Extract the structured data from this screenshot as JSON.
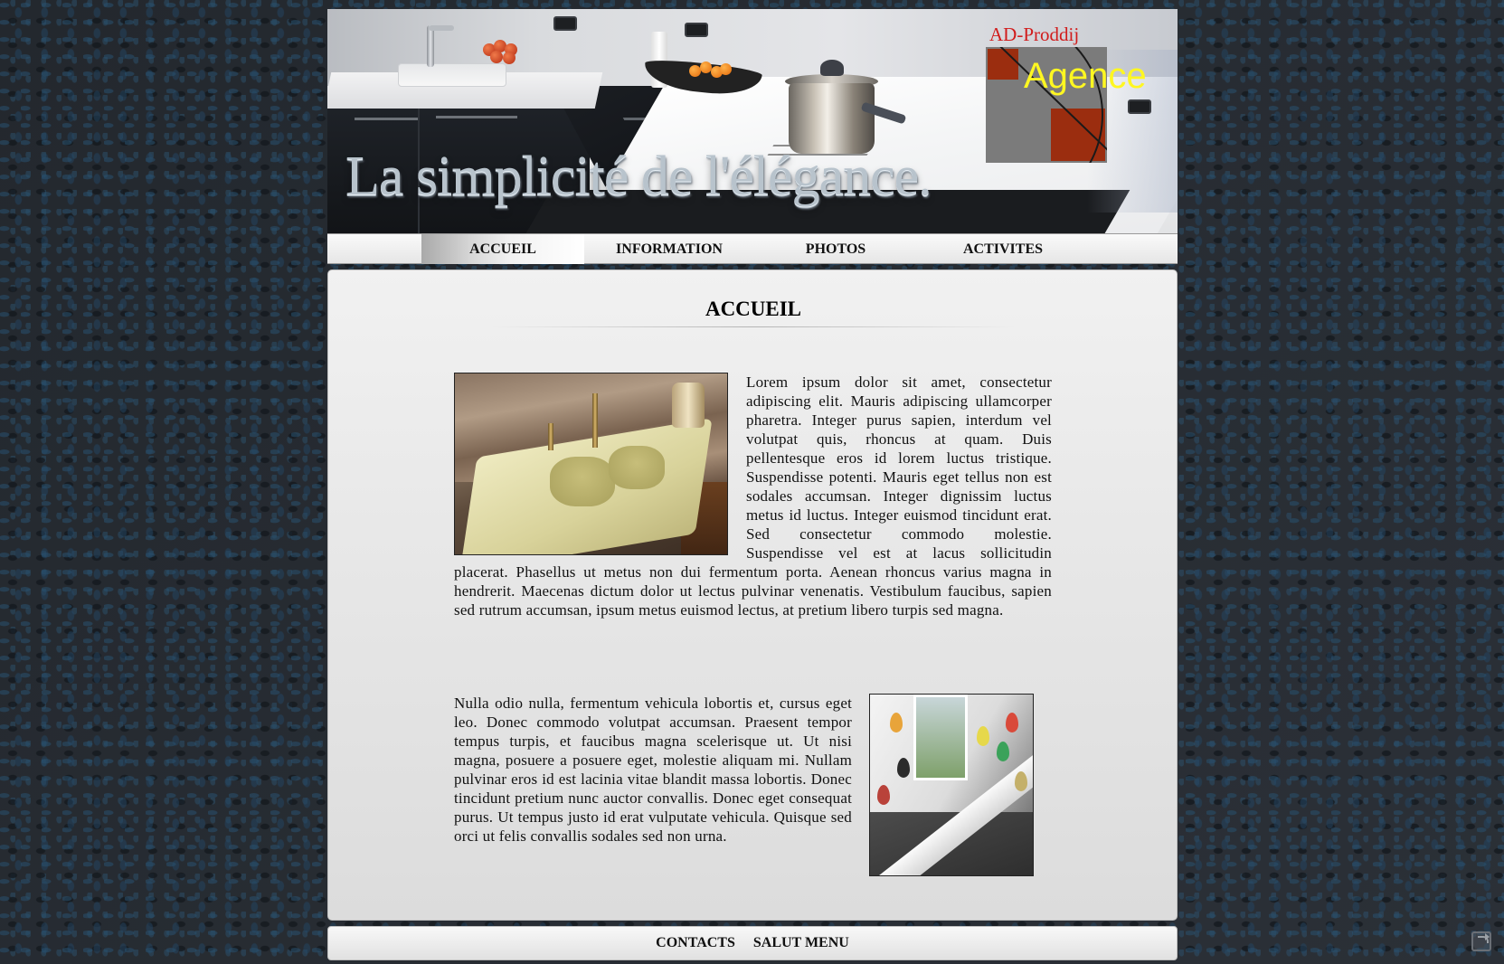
{
  "header": {
    "slogan": "La simplicité de l'élégance.",
    "logo": {
      "brand": "AD-Proddij",
      "name": "Agence",
      "colors": {
        "brand": "#d11c1c",
        "name": "#fff721",
        "tile": "#9b2d0f",
        "box": "#7b7b7b"
      }
    }
  },
  "nav": {
    "items": [
      {
        "label": "ACCUEIL",
        "active": true
      },
      {
        "label": "INFORMATION",
        "active": false
      },
      {
        "label": "PHOTOS",
        "active": false
      },
      {
        "label": "ACTIVITES",
        "active": false
      }
    ]
  },
  "main": {
    "title": "ACCUEIL",
    "paragraph1": "Lorem ipsum dolor sit amet, consectetur adipiscing elit. Mauris adipiscing ullamcorper pharetra. Integer purus sapien, interdum vel volutpat quis, rhoncus at quam. Duis pellentesque eros id lorem luctus tristique. Suspendisse potenti. Mauris eget tellus non est sodales accumsan. Integer dignissim luctus metus id luctus. Integer euismod tincidunt erat. Sed consectetur commodo molestie. Suspendisse vel est at lacus sollicitudin placerat. Phasellus ut metus non dui fermentum porta. Aenean rhoncus varius magna in hendrerit. Maecenas dictum dolor ut lectus pulvinar venenatis. Vestibulum faucibus, sapien sed rutrum accumsan, ipsum metus euismod lectus, at pretium libero turpis sed magna.",
    "paragraph2": "Nulla odio nulla, fermentum vehicula lobortis et, cursus eget leo. Donec commodo volutpat accumsan. Praesent tempor tempus turpis, et faucibus magna scelerisque ut. Ut nisi magna, posuere a posuere eget, molestie aliquam mi. Nullam pulvinar eros id est lacinia vitae blandit massa lobortis. Donec tincidunt pretium nunc auctor convallis. Donec eget consequat purus. Ut tempus justo id erat vulputate vehicula. Quisque sed orci ut felis convallis sodales sed non urna."
  },
  "footer": {
    "links": [
      "CONTACTS",
      "SALUT MENU"
    ]
  },
  "icons": {
    "share": "share-icon"
  },
  "colors": {
    "background": "#252a30",
    "nav_text": "#111111",
    "panel": "#e8e8e8"
  }
}
